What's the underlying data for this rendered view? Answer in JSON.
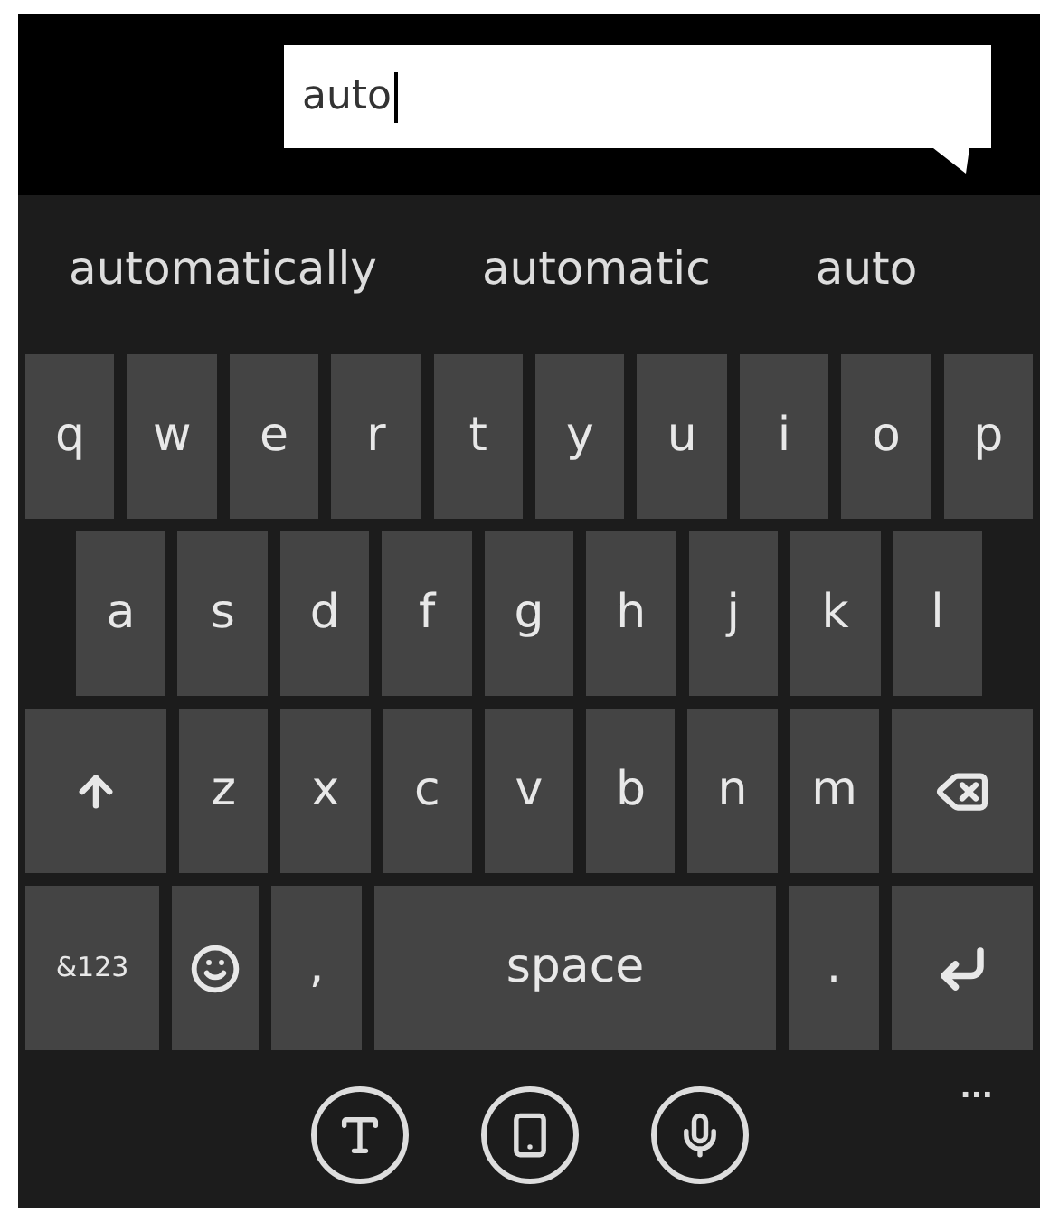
{
  "text_field": {
    "value": "auto"
  },
  "suggestions": [
    "automatically",
    "automatic",
    "auto"
  ],
  "keyboard_rows": [
    [
      {
        "kind": "letter",
        "label": "q"
      },
      {
        "kind": "letter",
        "label": "w"
      },
      {
        "kind": "letter",
        "label": "e"
      },
      {
        "kind": "letter",
        "label": "r"
      },
      {
        "kind": "letter",
        "label": "t"
      },
      {
        "kind": "letter",
        "label": "y"
      },
      {
        "kind": "letter",
        "label": "u"
      },
      {
        "kind": "letter",
        "label": "i"
      },
      {
        "kind": "letter",
        "label": "o"
      },
      {
        "kind": "letter",
        "label": "p"
      }
    ],
    [
      {
        "kind": "letter",
        "label": "a"
      },
      {
        "kind": "letter",
        "label": "s"
      },
      {
        "kind": "letter",
        "label": "d"
      },
      {
        "kind": "letter",
        "label": "f"
      },
      {
        "kind": "letter",
        "label": "g"
      },
      {
        "kind": "letter",
        "label": "h"
      },
      {
        "kind": "letter",
        "label": "j"
      },
      {
        "kind": "letter",
        "label": "k"
      },
      {
        "kind": "letter",
        "label": "l"
      }
    ],
    [
      {
        "kind": "shift"
      },
      {
        "kind": "letter",
        "label": "z"
      },
      {
        "kind": "letter",
        "label": "x"
      },
      {
        "kind": "letter",
        "label": "c"
      },
      {
        "kind": "letter",
        "label": "v"
      },
      {
        "kind": "letter",
        "label": "b"
      },
      {
        "kind": "letter",
        "label": "n"
      },
      {
        "kind": "letter",
        "label": "m"
      },
      {
        "kind": "backspace"
      }
    ],
    [
      {
        "kind": "symbols",
        "label": "&123"
      },
      {
        "kind": "emoji"
      },
      {
        "kind": "letter",
        "label": ","
      },
      {
        "kind": "space",
        "label": "space"
      },
      {
        "kind": "letter",
        "label": "."
      },
      {
        "kind": "enter"
      }
    ]
  ],
  "more_label": "..."
}
